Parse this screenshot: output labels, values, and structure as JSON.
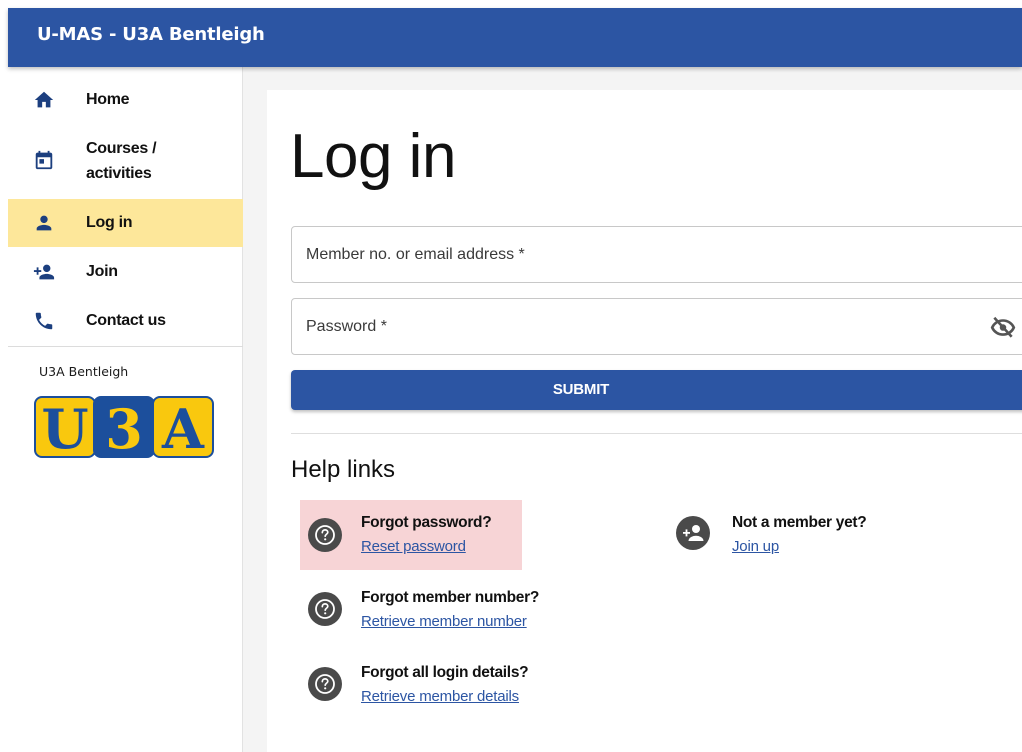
{
  "header": {
    "title": "U-MAS - U3A Bentleigh"
  },
  "sidebar": {
    "items": [
      {
        "label": "Home",
        "icon": "home-icon"
      },
      {
        "label": "Courses /",
        "label2": "activities",
        "icon": "calendar-icon"
      },
      {
        "label": "Log in",
        "icon": "person-icon",
        "active": true
      },
      {
        "label": "Join",
        "icon": "person-add-icon"
      },
      {
        "label": "Contact us",
        "icon": "phone-icon"
      }
    ],
    "org_name": "U3A Bentleigh",
    "logo": {
      "letters": [
        "U",
        "3",
        "A"
      ],
      "colors": {
        "yellow": "#f9c80e",
        "blue": "#1c4f9c"
      }
    },
    "active_color": "#fde79a"
  },
  "main": {
    "title": "Log in",
    "form": {
      "member_field": {
        "placeholder": "Member no. or email address *",
        "value": ""
      },
      "password_field": {
        "placeholder": "Password *",
        "value": ""
      },
      "submit_label": "SUBMIT"
    },
    "help": {
      "title": "Help links",
      "items": [
        {
          "heading": "Forgot password?",
          "link": "Reset password",
          "icon": "help-circle-icon",
          "highlighted": true
        },
        {
          "heading": "Not a member yet?",
          "link": "Join up",
          "icon": "person-add-icon"
        },
        {
          "heading": "Forgot member number?",
          "link": "Retrieve member number",
          "icon": "help-circle-icon"
        },
        {
          "heading": "Forgot all login details?",
          "link": "Retrieve member details",
          "icon": "help-circle-icon"
        }
      ]
    }
  },
  "colors": {
    "primary": "#2c55a3",
    "highlight": "#f7d4d6",
    "link": "#2c55a3"
  }
}
